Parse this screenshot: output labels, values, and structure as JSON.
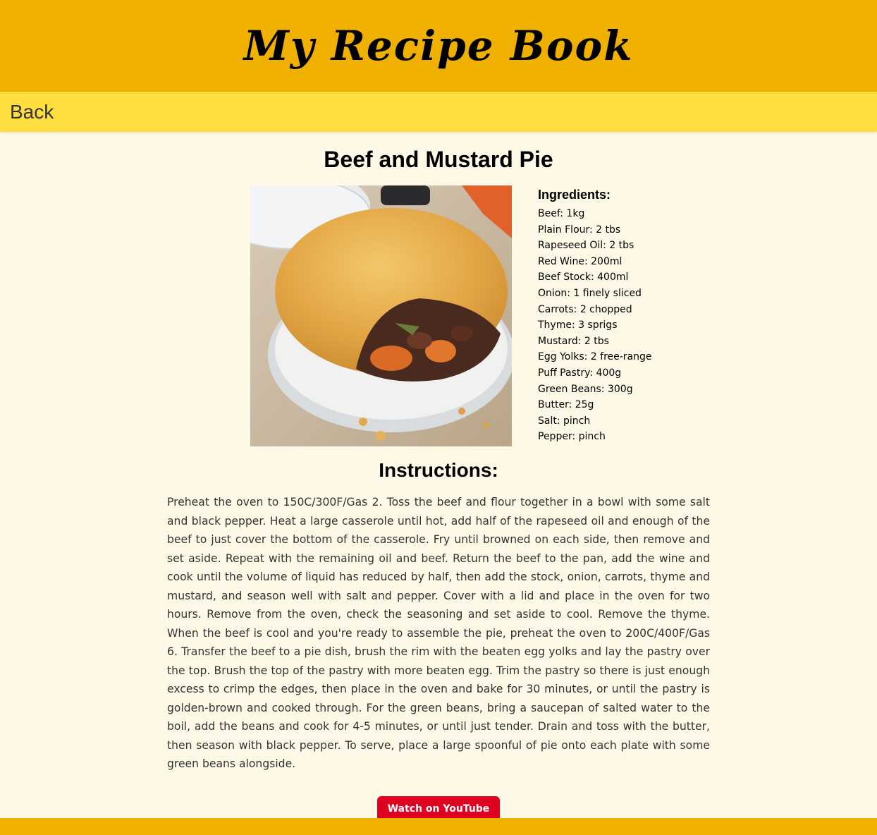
{
  "header": {
    "title": "My Recipe Book"
  },
  "nav": {
    "back_label": "Back"
  },
  "recipe": {
    "title": "Beef and Mustard Pie",
    "image_subject": "beef-and-mustard-pie-photo",
    "ingredients_heading": "Ingredients:",
    "ingredients": [
      "Beef: 1kg",
      "Plain Flour: 2 tbs",
      "Rapeseed Oil: 2 tbs",
      "Red Wine: 200ml",
      "Beef Stock: 400ml",
      "Onion: 1 finely sliced",
      "Carrots: 2 chopped",
      "Thyme: 3 sprigs",
      "Mustard: 2 tbs",
      "Egg Yolks: 2 free-range",
      "Puff Pastry: 400g",
      "Green Beans: 300g",
      "Butter: 25g",
      "Salt: pinch",
      "Pepper: pinch"
    ],
    "instructions_heading": "Instructions:",
    "instructions": "Preheat the oven to 150C/300F/Gas 2. Toss the beef and flour together in a bowl with some salt and black pepper. Heat a large casserole until hot, add half of the rapeseed oil and enough of the beef to just cover the bottom of the casserole. Fry until browned on each side, then remove and set aside. Repeat with the remaining oil and beef. Return the beef to the pan, add the wine and cook until the volume of liquid has reduced by half, then add the stock, onion, carrots, thyme and mustard, and season well with salt and pepper. Cover with a lid and place in the oven for two hours. Remove from the oven, check the seasoning and set aside to cool. Remove the thyme. When the beef is cool and you're ready to assemble the pie, preheat the oven to 200C/400F/Gas 6. Transfer the beef to a pie dish, brush the rim with the beaten egg yolks and lay the pastry over the top. Brush the top of the pastry with more beaten egg. Trim the pastry so there is just enough excess to crimp the edges, then place in the oven and bake for 30 minutes, or until the pastry is golden-brown and cooked through. For the green beans, bring a saucepan of salted water to the boil, add the beans and cook for 4-5 minutes, or until just tender. Drain and toss with the butter, then season with black pepper. To serve, place a large spoonful of pie onto each plate with some green beans alongside.",
    "video_button_label": "Watch on YouTube"
  },
  "colors": {
    "header_bg": "#f0b000",
    "nav_bg": "#ffdf3f",
    "page_bg": "#fef9e6",
    "youtube_red": "#e00020"
  }
}
